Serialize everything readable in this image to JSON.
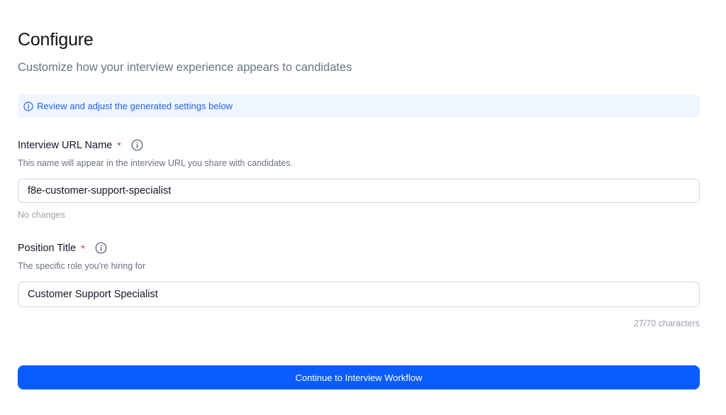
{
  "header": {
    "title": "Configure",
    "subtitle": "Customize how your interview experience appears to candidates"
  },
  "notice": {
    "icon": "info-circle-icon",
    "text": "Review and adjust the generated settings below",
    "color": "#2563eb",
    "background": "#eff6ff"
  },
  "url_name_field": {
    "label": "Interview URL Name",
    "required_marker": "*",
    "help_icon": "info-icon",
    "description": "This name will appear in the interview URL you share with candidates.",
    "value": "f8e-customer-support-specialist",
    "status": "No changes"
  },
  "position_title_field": {
    "label": "Position Title",
    "required_marker": "*",
    "help_icon": "info-icon",
    "description": "The specific role you're hiring for",
    "value": "Customer Support Specialist",
    "char_count": "27/70 characters"
  },
  "actions": {
    "continue_label": "Continue to Interview Workflow",
    "continue_color": "#0a5cff"
  }
}
